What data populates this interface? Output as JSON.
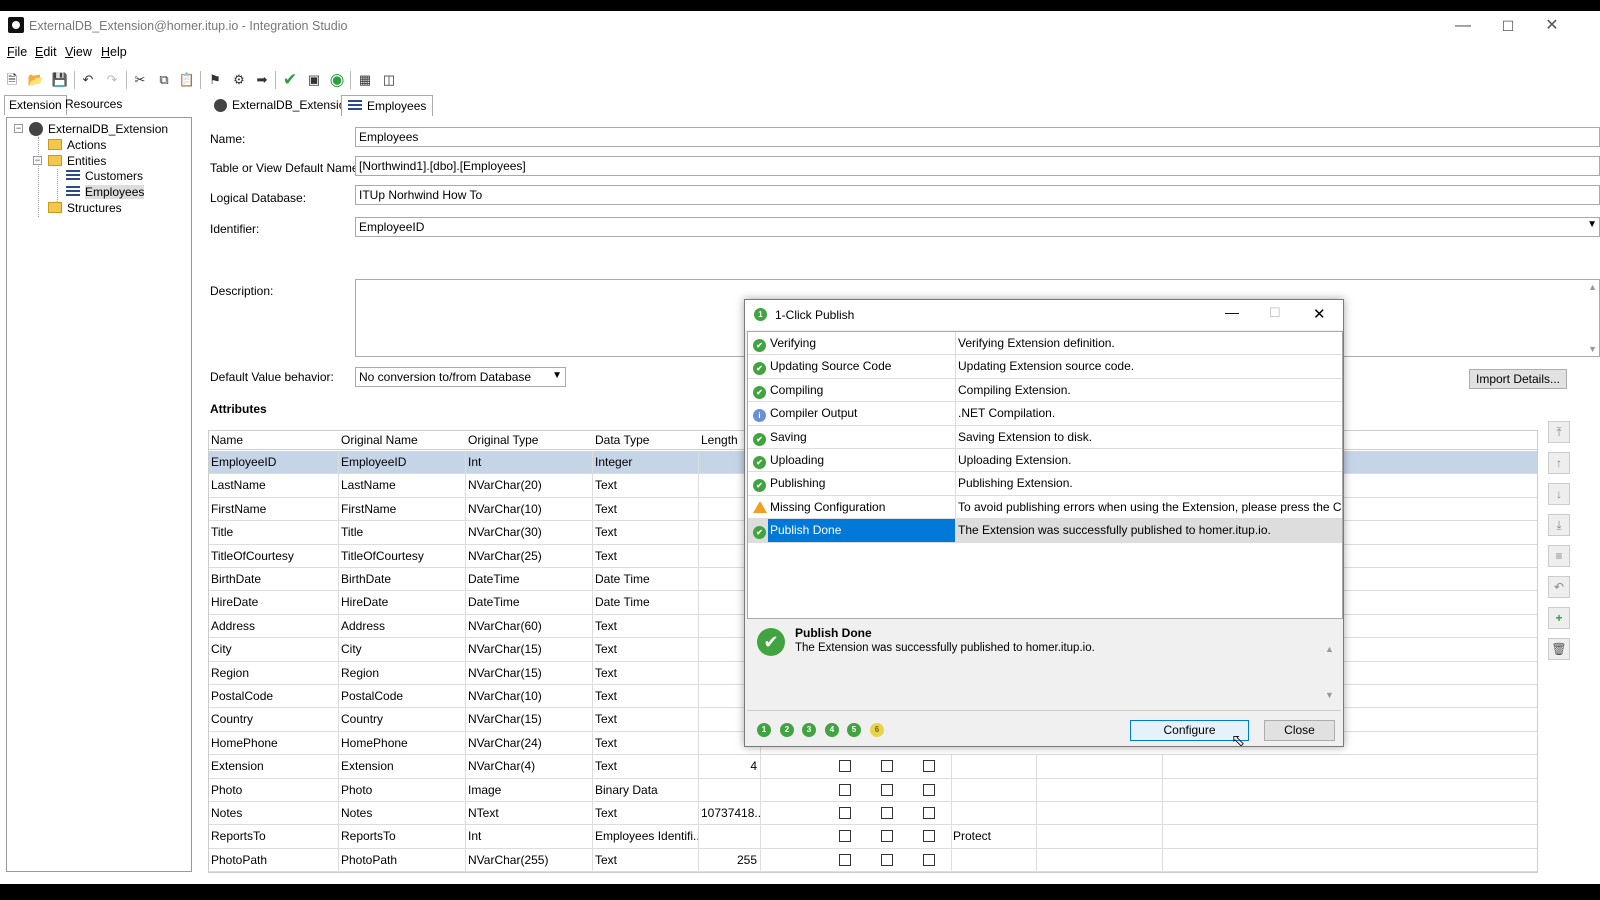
{
  "window": {
    "title": "ExternalDB_Extension@homer.itup.io - Integration Studio"
  },
  "menu": [
    "File",
    "Edit",
    "View",
    "Help"
  ],
  "left_tabs": [
    "Extension",
    "Resources"
  ],
  "tree": {
    "root": "ExternalDB_Extension",
    "actions": "Actions",
    "entities": "Entities",
    "customers": "Customers",
    "employees": "Employees",
    "structures": "Structures"
  },
  "doc_tabs": [
    "ExternalDB_Extension",
    "Employees"
  ],
  "form": {
    "name_label": "Name:",
    "name_value": "Employees",
    "table_label": "Table or View Default Name:",
    "table_value": "[Northwind1].[dbo].[Employees]",
    "logical_label": "Logical Database:",
    "logical_value": "ITUp Norhwind How To",
    "identifier_label": "Identifier:",
    "identifier_value": "EmployeeID",
    "description_label": "Description:",
    "default_label": "Default Value behavior:",
    "default_value": "No conversion to/from Database",
    "import_btn": "Import Details..."
  },
  "attributes": {
    "title": "Attributes",
    "headers": [
      "Name",
      "Original Name",
      "Original Type",
      "Data Type",
      "Length"
    ],
    "rows": [
      [
        "EmployeeID",
        "EmployeeID",
        "Int",
        "Integer",
        ""
      ],
      [
        "LastName",
        "LastName",
        "NVarChar(20)",
        "Text",
        ""
      ],
      [
        "FirstName",
        "FirstName",
        "NVarChar(10)",
        "Text",
        ""
      ],
      [
        "Title",
        "Title",
        "NVarChar(30)",
        "Text",
        ""
      ],
      [
        "TitleOfCourtesy",
        "TitleOfCourtesy",
        "NVarChar(25)",
        "Text",
        ""
      ],
      [
        "BirthDate",
        "BirthDate",
        "DateTime",
        "Date Time",
        ""
      ],
      [
        "HireDate",
        "HireDate",
        "DateTime",
        "Date Time",
        ""
      ],
      [
        "Address",
        "Address",
        "NVarChar(60)",
        "Text",
        ""
      ],
      [
        "City",
        "City",
        "NVarChar(15)",
        "Text",
        ""
      ],
      [
        "Region",
        "Region",
        "NVarChar(15)",
        "Text",
        ""
      ],
      [
        "PostalCode",
        "PostalCode",
        "NVarChar(10)",
        "Text",
        ""
      ],
      [
        "Country",
        "Country",
        "NVarChar(15)",
        "Text",
        ""
      ],
      [
        "HomePhone",
        "HomePhone",
        "NVarChar(24)",
        "Text",
        ""
      ],
      [
        "Extension",
        "Extension",
        "NVarChar(4)",
        "Text",
        "4"
      ],
      [
        "Photo",
        "Photo",
        "Image",
        "Binary Data",
        ""
      ],
      [
        "Notes",
        "Notes",
        "NText",
        "Text",
        "10737418..."
      ],
      [
        "ReportsTo",
        "ReportsTo",
        "Int",
        "Employees Identifi...",
        ""
      ],
      [
        "PhotoPath",
        "PhotoPath",
        "NVarChar(255)",
        "Text",
        "255"
      ]
    ],
    "reportsto_extra": "Protect"
  },
  "dialog": {
    "title": "1-Click Publish",
    "steps": [
      {
        "name": "Verifying",
        "desc": "Verifying Extension definition.",
        "icon": "step-ok"
      },
      {
        "name": "Updating Source Code",
        "desc": "Updating Extension source code.",
        "icon": "step-ok"
      },
      {
        "name": "Compiling",
        "desc": "Compiling Extension.",
        "icon": "step-ok"
      },
      {
        "name": "Compiler Output",
        "desc": ".NET Compilation.",
        "icon": "info"
      },
      {
        "name": "Saving",
        "desc": "Saving Extension to disk.",
        "icon": "step-ok"
      },
      {
        "name": "Uploading",
        "desc": "Uploading Extension.",
        "icon": "step-ok"
      },
      {
        "name": "Publishing",
        "desc": "Publishing Extension.",
        "icon": "step-ok"
      },
      {
        "name": "Missing Configuration",
        "desc": "To avoid publishing errors when using the Extension, please press the Confi...",
        "icon": "warning"
      },
      {
        "name": "Publish Done",
        "desc": "The Extension was successfully published to homer.itup.io.",
        "icon": "check"
      }
    ],
    "result_title": "Publish Done",
    "result_text": "The Extension was successfully published to homer.itup.io.",
    "step_numbers": [
      "1",
      "2",
      "3",
      "4",
      "5",
      "6"
    ],
    "configure_btn": "Configure",
    "close_btn": "Close"
  }
}
